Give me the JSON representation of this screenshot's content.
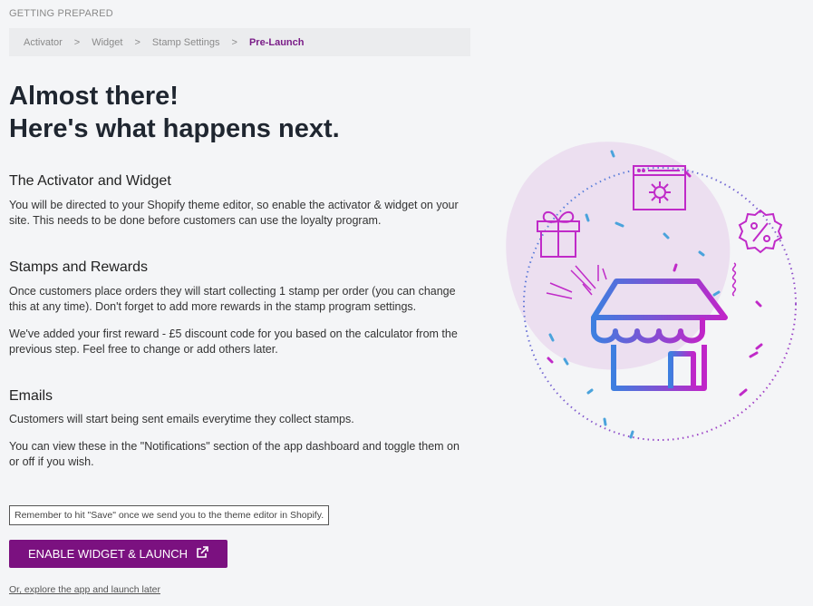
{
  "section_label": "GETTING PREPARED",
  "breadcrumb": [
    "Activator",
    "Widget",
    "Stamp Settings",
    "Pre-Launch"
  ],
  "breadcrumb_separator": ">",
  "headline": [
    "Almost there!",
    "Here's what happens next."
  ],
  "sections": [
    {
      "title": "The Activator and Widget",
      "paragraphs": [
        "You will be directed to your Shopify theme editor, so enable the activator & widget on your site. This needs to be done before customers can use the loyalty program."
      ]
    },
    {
      "title": "Stamps and Rewards",
      "paragraphs": [
        "Once customers place orders they will start collecting 1 stamp per order (you can change this at any time). Don't forget to add more rewards in the stamp program settings.",
        "We've added your first reward - £5 discount code for you based on the calculator from the previous step. Feel free to change or add others later."
      ]
    },
    {
      "title": "Emails",
      "paragraphs": [
        "Customers will start being sent emails everytime they collect stamps.",
        "You can view these in the \"Notifications\" section of the app dashboard and toggle them on or off if you wish."
      ]
    }
  ],
  "note": "Remember to hit \"Save\" once we send you to the theme editor in Shopify.",
  "cta_label": "ENABLE WIDGET & LAUNCH",
  "later_link": "Or, explore the app and launch later",
  "colors": {
    "accent": "#7b1180",
    "active_crumb": "#7a1d88",
    "background": "#f4f5f7"
  },
  "icons": [
    "external-link-icon",
    "store-icon",
    "gift-icon",
    "settings-window-icon",
    "discount-badge-icon"
  ]
}
